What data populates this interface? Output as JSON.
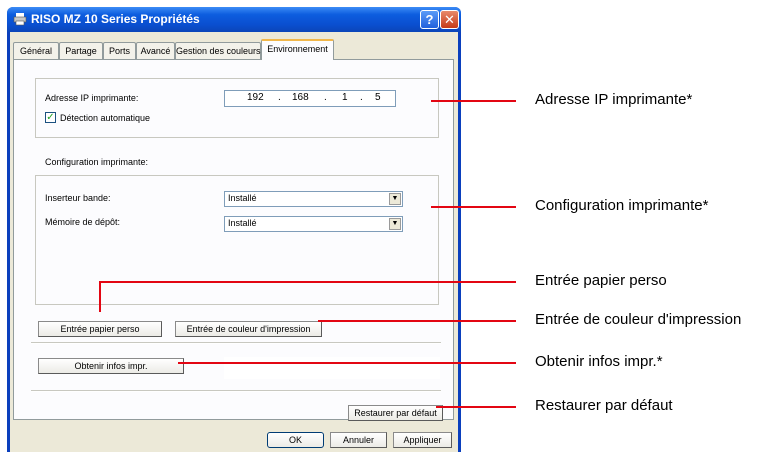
{
  "window": {
    "title": "RISO MZ 10 Series Propriétés",
    "help_label": "?",
    "close_label": "✕"
  },
  "tabs": [
    {
      "label": "Général"
    },
    {
      "label": "Partage"
    },
    {
      "label": "Ports"
    },
    {
      "label": "Avancé"
    },
    {
      "label": "Gestion des couleurs"
    },
    {
      "label": "Environnement",
      "active": true
    }
  ],
  "ip_section": {
    "label": "Adresse IP imprimante:",
    "octets": [
      "192",
      "168",
      "1",
      "5"
    ],
    "separator": ".",
    "auto_detect_label": "Détection automatique",
    "auto_detect_checked": true
  },
  "printer_config": {
    "heading": "Configuration imprimante:",
    "rows": [
      {
        "label": "Inserteur bande:",
        "value": "Installé"
      },
      {
        "label": "Mémoire de dépôt:",
        "value": "Installé"
      }
    ]
  },
  "buttons": {
    "custom_paper": "Entrée papier perso",
    "print_color_entry": "Entrée de couleur d'impression",
    "get_info": "Obtenir infos impr.",
    "restore_defaults": "Restaurer par défaut",
    "ok": "OK",
    "cancel": "Annuler",
    "apply": "Appliquer"
  },
  "callouts": {
    "ip_address": "Adresse IP imprimante*",
    "printer_config": "Configuration imprimante*",
    "custom_paper": "Entrée papier perso",
    "print_color_entry": "Entrée de couleur d'impression",
    "get_info": "Obtenir infos impr.*",
    "restore_defaults": "Restaurer par défaut"
  },
  "colors": {
    "callout_line": "#e30613",
    "title_bar": "#0a4fd0",
    "dialog_face": "#ece9d8",
    "active_tab_highlight": "#f1b74a"
  }
}
